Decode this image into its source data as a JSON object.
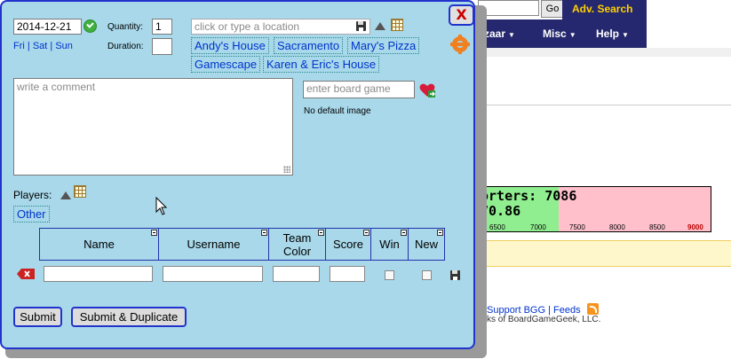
{
  "background": {
    "go_button": "Go",
    "adv_search": "Adv. Search",
    "nav_menus": [
      {
        "label": "zaar"
      },
      {
        "label": "Misc"
      },
      {
        "label": "Help"
      }
    ],
    "supporters_line": "orters: 7086",
    "supporters_value": "70.86",
    "gauge_ticks": [
      "6500",
      "7000",
      "7500",
      "8000",
      "8500",
      "9000"
    ],
    "footer": {
      "support_link": "Support BGG",
      "feeds_link": "Feeds",
      "separator": "|",
      "copyright": "ks of BoardGameGeek, LLC."
    }
  },
  "dialog": {
    "close_label": "X",
    "date_value": "2014-12-21",
    "day_links": [
      "Fri",
      "Sat",
      "Sun"
    ],
    "day_sep": "|",
    "quantity_label": "Quantity:",
    "quantity_value": "1",
    "duration_label": "Duration:",
    "duration_value": "",
    "location_placeholder": "click or type a location",
    "locations": [
      "Andy's House",
      "Sacramento",
      "Mary's Pizza",
      "Gamescape",
      "Karen & Eric's House"
    ],
    "comment_placeholder": "write a comment",
    "game_placeholder": "enter board game",
    "no_image_text": "No default image",
    "players_label": "Players:",
    "other_label": "Other",
    "table_columns": [
      "Name",
      "Username",
      "Team Color",
      "Score",
      "Win",
      "New"
    ],
    "submit_label": "Submit",
    "submit_dup_label": "Submit & Duplicate"
  }
}
